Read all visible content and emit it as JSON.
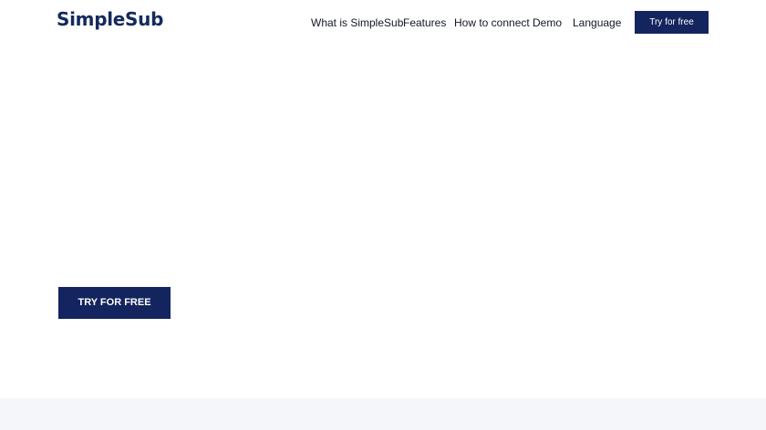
{
  "header": {
    "logo": "SimpleSub",
    "nav": [
      "What is SimpleSub",
      "Features",
      "How to connect",
      "Demo",
      "Language"
    ],
    "cta_label": "Try for free"
  },
  "hero": {
    "cta_label": "TRY FOR FREE"
  },
  "colors": {
    "brand": "#132a5c",
    "button": "#13245e",
    "band": "#f4f6f9"
  }
}
